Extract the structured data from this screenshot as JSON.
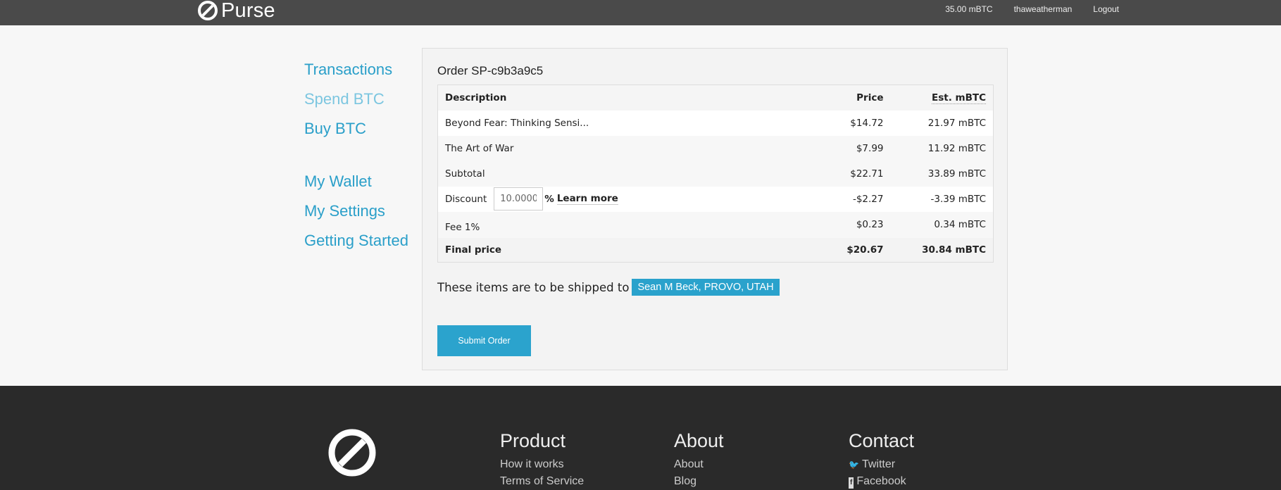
{
  "header": {
    "brand": "Purse",
    "balance": "35.00 mBTC",
    "username": "thaweatherman",
    "logout": "Logout"
  },
  "sidebar": {
    "items": [
      {
        "label": "Transactions"
      },
      {
        "label": "Spend BTC"
      },
      {
        "label": "Buy BTC"
      },
      {
        "label": "My Wallet"
      },
      {
        "label": "My Settings"
      },
      {
        "label": "Getting Started"
      }
    ]
  },
  "order": {
    "title": "Order SP-c9b3a9c5",
    "columns": {
      "description": "Description",
      "price": "Price",
      "btc": "Est. mBTC"
    },
    "items": [
      {
        "description": "Beyond Fear: Thinking Sensi...",
        "price": "$14.72",
        "btc": "21.97 mBTC"
      },
      {
        "description": "The Art of War",
        "price": "$7.99",
        "btc": "11.92 mBTC"
      }
    ],
    "subtotal": {
      "label": "Subtotal",
      "price": "$22.71",
      "btc": "33.89 mBTC"
    },
    "discount": {
      "label": "Discount",
      "value": "10.0000",
      "percent": "%",
      "learn_more": "Learn more",
      "price": "-$2.27",
      "btc": "-3.39 mBTC"
    },
    "fee": {
      "label": "Fee 1%",
      "price": "$0.23",
      "btc": "0.34 mBTC"
    },
    "final": {
      "label": "Final price",
      "price": "$20.67",
      "btc": "30.84 mBTC"
    },
    "ship_text": "These items are to be shipped to",
    "ship_to": "Sean M Beck, PROVO, UTAH",
    "submit": "Submit Order"
  },
  "footer": {
    "product": {
      "title": "Product",
      "links": [
        "How it works",
        "Terms of Service"
      ]
    },
    "about": {
      "title": "About",
      "links": [
        "About",
        "Blog"
      ]
    },
    "contact": {
      "title": "Contact",
      "links": [
        {
          "icon": "twitter-icon",
          "label": "Twitter"
        },
        {
          "icon": "facebook-icon",
          "label": "Facebook"
        }
      ]
    }
  },
  "colors": {
    "accent": "#2aa2cc",
    "topbar": "#4a4a4a",
    "footer": "#2a2a2a"
  }
}
